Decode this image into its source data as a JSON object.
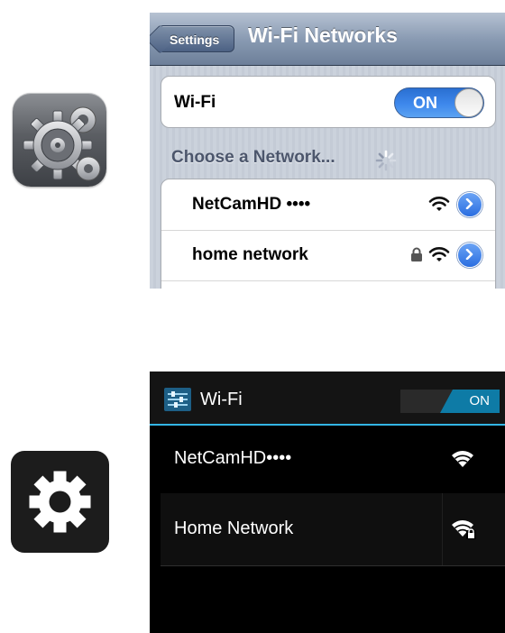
{
  "ios": {
    "back_button": "Settings",
    "title": "Wi-Fi Networks",
    "wifi_label": "Wi-Fi",
    "wifi_toggle": "ON",
    "section_label": "Choose a Network...",
    "networks": [
      {
        "name": "NetCamHD ••••",
        "secured": false
      },
      {
        "name": "home network",
        "secured": true
      }
    ],
    "icons": {
      "app": "settings-gears-icon",
      "spinner": "spinner-icon",
      "signal": "wifi-signal-icon",
      "lock": "lock-icon",
      "detail": "detail-disclosure-icon"
    },
    "colors": {
      "toggle": "#3e88ec",
      "navbar": "#6d7f99"
    }
  },
  "android": {
    "title": "Wi-Fi",
    "switch": "ON",
    "networks": [
      {
        "name": "NetCamHD••••",
        "secured": false
      },
      {
        "name": "Home Network",
        "secured": true
      }
    ],
    "icons": {
      "app": "settings-cog-icon",
      "header": "settings-sliders-icon",
      "signal": "wifi-signal-icon",
      "signal_lock": "wifi-lock-icon"
    },
    "colors": {
      "accent": "#33b5e5",
      "switch_on": "#0e7ba6"
    }
  }
}
